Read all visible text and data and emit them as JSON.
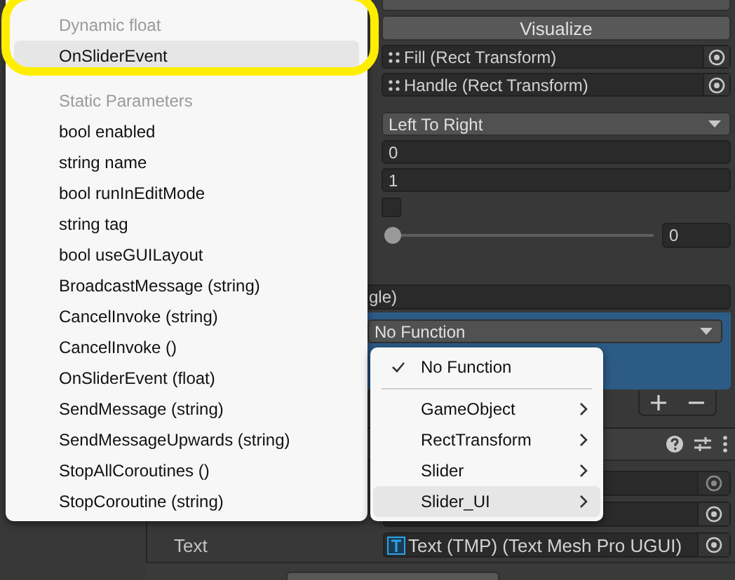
{
  "inspector": {
    "visualize_button": "Visualize",
    "object_fields": [
      {
        "value": "Fill (Rect Transform)"
      },
      {
        "value": "Handle (Rect Transform)"
      }
    ],
    "direction_dropdown": "Left To Right",
    "min_value": "0",
    "max_value": "1",
    "whole_numbers": {
      "checked": false
    },
    "value_slider": {
      "level": 0,
      "reading": "0"
    },
    "event_header": "gle)",
    "function_dropdown": "No Function",
    "text_field": {
      "label": "Text",
      "value": "Text (TMP) (Text Mesh Pro UGUI)"
    }
  },
  "method_menu": {
    "sections": [
      {
        "header": "Dynamic float",
        "highlighted": true,
        "items": [
          {
            "label": "OnSliderEvent",
            "selected": true
          }
        ]
      },
      {
        "header": "Static Parameters",
        "highlighted": false,
        "items": [
          {
            "label": "bool enabled",
            "selected": false
          },
          {
            "label": "string name",
            "selected": false
          },
          {
            "label": "bool runInEditMode",
            "selected": false
          },
          {
            "label": "string tag",
            "selected": false
          },
          {
            "label": "bool useGUILayout",
            "selected": false
          },
          {
            "label": "BroadcastMessage (string)",
            "selected": false
          },
          {
            "label": "CancelInvoke (string)",
            "selected": false
          },
          {
            "label": "CancelInvoke ()",
            "selected": false
          },
          {
            "label": "OnSliderEvent (float)",
            "selected": false
          },
          {
            "label": "SendMessage (string)",
            "selected": false
          },
          {
            "label": "SendMessageUpwards (string)",
            "selected": false
          },
          {
            "label": "StopAllCoroutines ()",
            "selected": false
          },
          {
            "label": "StopCoroutine (string)",
            "selected": false
          }
        ]
      }
    ]
  },
  "component_menu": {
    "items": [
      {
        "kind": "check",
        "label": "No Function",
        "checked": true
      },
      {
        "kind": "separator"
      },
      {
        "kind": "submenu",
        "label": "GameObject",
        "selected": false
      },
      {
        "kind": "submenu",
        "label": "RectTransform",
        "selected": false
      },
      {
        "kind": "submenu",
        "label": "Slider",
        "selected": false
      },
      {
        "kind": "submenu",
        "label": "Slider_UI",
        "selected": true
      }
    ]
  }
}
